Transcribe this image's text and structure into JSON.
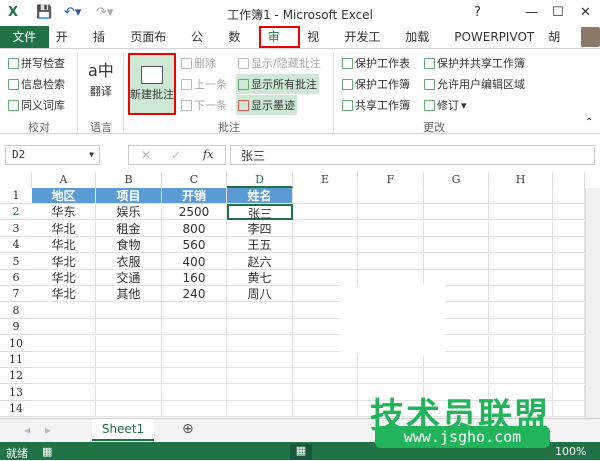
{
  "window": {
    "title": "工作簿1 - Microsoft Excel",
    "help": "?",
    "minimize": "—",
    "maximize": "☐",
    "close": "✕"
  },
  "tabs": [
    "文件",
    "开始",
    "插入",
    "页面布局",
    "公式",
    "数据",
    "审阅",
    "视图",
    "开发工具",
    "加载项",
    "POWERPIVOT"
  ],
  "active_tab": "审阅",
  "user": "胡俊",
  "ribbon": {
    "proofing": {
      "items": [
        "拼写检查",
        "信息检索",
        "同义词库"
      ],
      "label": "校对"
    },
    "language": {
      "items": [
        "翻译"
      ],
      "label": "语言"
    },
    "comments": {
      "new": "新建批注",
      "delete": "删除",
      "prev": "上一条",
      "next": "下一条",
      "toggle": "显示/隐藏批注",
      "show_all": "显示所有批注",
      "show_ink": "显示墨迹",
      "label": "批注"
    },
    "changes": {
      "items": [
        "保护工作表",
        "保护工作簿",
        "共享工作簿",
        "保护并共享工作簿",
        "允许用户编辑区域",
        "修订"
      ],
      "label": "更改"
    }
  },
  "formula_bar": {
    "name_box": "D2",
    "value": "张三",
    "fx": "fx"
  },
  "columns": [
    "A",
    "B",
    "C",
    "D",
    "E",
    "F",
    "G",
    "H"
  ],
  "rows": [
    "1",
    "2",
    "3",
    "4",
    "5",
    "6",
    "7",
    "8",
    "9",
    "10",
    "11",
    "12",
    "13",
    "14"
  ],
  "table": {
    "headers": [
      "地区",
      "项目",
      "开销",
      "姓名"
    ],
    "data": [
      [
        "华东",
        "娱乐",
        "2500",
        "张三"
      ],
      [
        "华北",
        "租金",
        "800",
        "李四"
      ],
      [
        "华北",
        "食物",
        "560",
        "王五"
      ],
      [
        "华北",
        "衣服",
        "400",
        "赵六"
      ],
      [
        "华北",
        "交通",
        "160",
        "黄七"
      ],
      [
        "华北",
        "其他",
        "240",
        "周八"
      ]
    ]
  },
  "selected_cell": "D2",
  "sheets": [
    "Sheet1"
  ],
  "status": {
    "ready": "就绪",
    "zoom": "100%"
  },
  "watermark": {
    "text": "技术员联盟",
    "url": "www.jsgho.com"
  },
  "colors": {
    "accent": "#217346",
    "header_fill": "#5b9bd5",
    "highlight": "#e00000"
  }
}
